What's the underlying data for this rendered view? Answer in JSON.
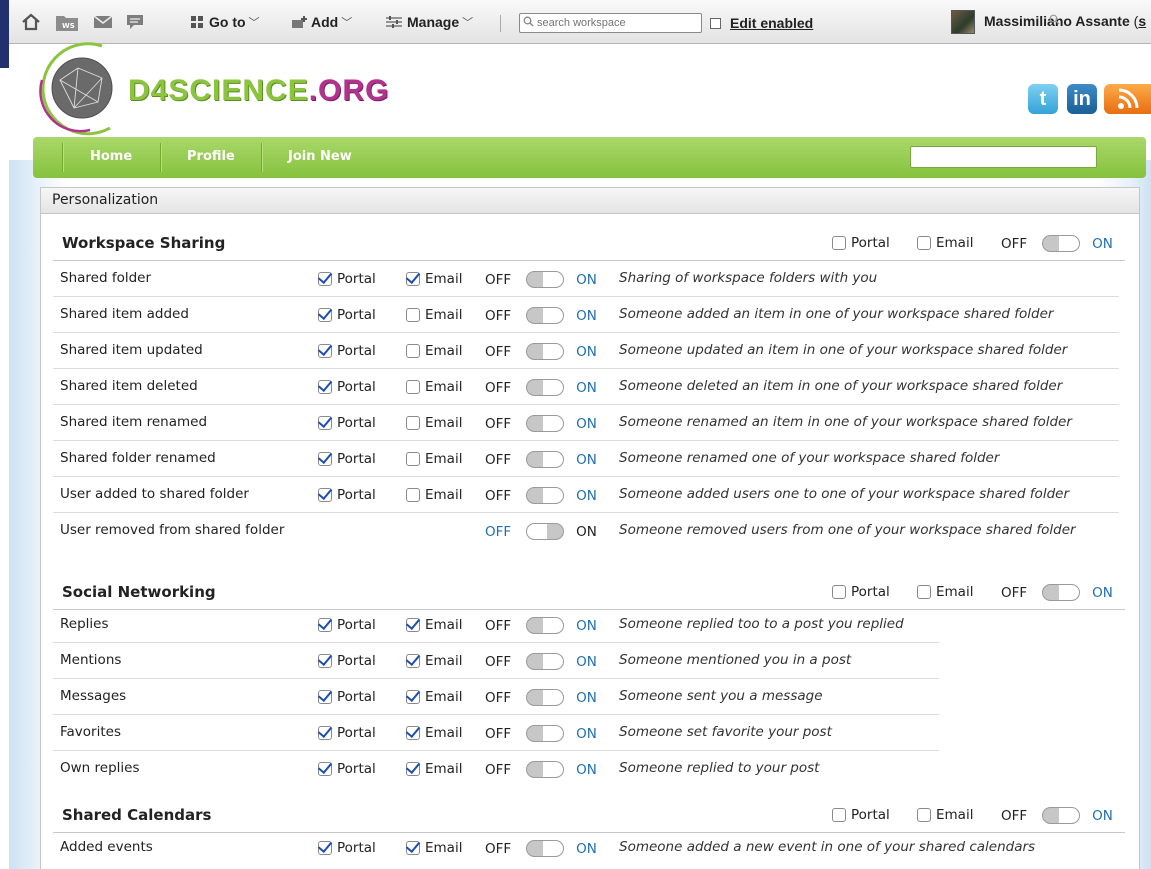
{
  "dock": {
    "goto_label": "Go to",
    "add_label": "Add",
    "manage_label": "Manage",
    "search_placeholder": "search workspace",
    "edit_label": "Edit enabled",
    "user_name": "Massimiliano Assante",
    "user_extra_open": " (",
    "user_extra_link": "s"
  },
  "header": {
    "logo_main": "D4SCIENCE",
    "logo_dot": ".ORG",
    "social": [
      "t",
      "in",
      "rss"
    ]
  },
  "nav": {
    "items": [
      "Home",
      "Profile",
      "Join New"
    ]
  },
  "panel": {
    "title": "Personalization"
  },
  "labels": {
    "portal": "Portal",
    "email": "Email",
    "off": "OFF",
    "on": "ON"
  },
  "sections": [
    {
      "title": "Workspace Sharing",
      "rows": [
        {
          "label": "Shared folder",
          "portal": true,
          "email": true,
          "desc": "Sharing of workspace folders with you"
        },
        {
          "label": "Shared item added",
          "portal": true,
          "email": false,
          "desc": "Someone added an item in one of your workspace shared folder"
        },
        {
          "label": "Shared item updated",
          "portal": true,
          "email": false,
          "desc": "Someone updated an item in one of your workspace shared folder"
        },
        {
          "label": "Shared item deleted",
          "portal": true,
          "email": false,
          "desc": "Someone deleted an item in one of your workspace shared folder"
        },
        {
          "label": "Shared item renamed",
          "portal": true,
          "email": false,
          "desc": "Someone renamed an item in one of your workspace shared folder"
        },
        {
          "label": "Shared folder renamed",
          "portal": true,
          "email": false,
          "desc": "Someone renamed one of your workspace shared folder"
        },
        {
          "label": "User added to shared folder",
          "portal": true,
          "email": false,
          "desc": "Someone added users one to one of your workspace shared folder"
        },
        {
          "label": "User removed from shared folder",
          "portal": null,
          "email": null,
          "desc": "Someone removed users from one of your workspace shared folder"
        }
      ]
    },
    {
      "title": "Social Networking",
      "rows": [
        {
          "label": "Replies",
          "portal": true,
          "email": true,
          "desc": "Someone replied too to a post you replied"
        },
        {
          "label": "Mentions",
          "portal": true,
          "email": true,
          "desc": "Someone mentioned you in a post"
        },
        {
          "label": "Messages",
          "portal": true,
          "email": true,
          "desc": "Someone sent you a message"
        },
        {
          "label": "Favorites",
          "portal": true,
          "email": true,
          "desc": "Someone set favorite your post"
        },
        {
          "label": "Own replies",
          "portal": true,
          "email": true,
          "desc": "Someone replied to your post"
        }
      ]
    },
    {
      "title": "Shared Calendars",
      "rows": [
        {
          "label": "Added events",
          "portal": true,
          "email": true,
          "desc": "Someone added a new event in one of your shared calendars"
        }
      ]
    }
  ]
}
